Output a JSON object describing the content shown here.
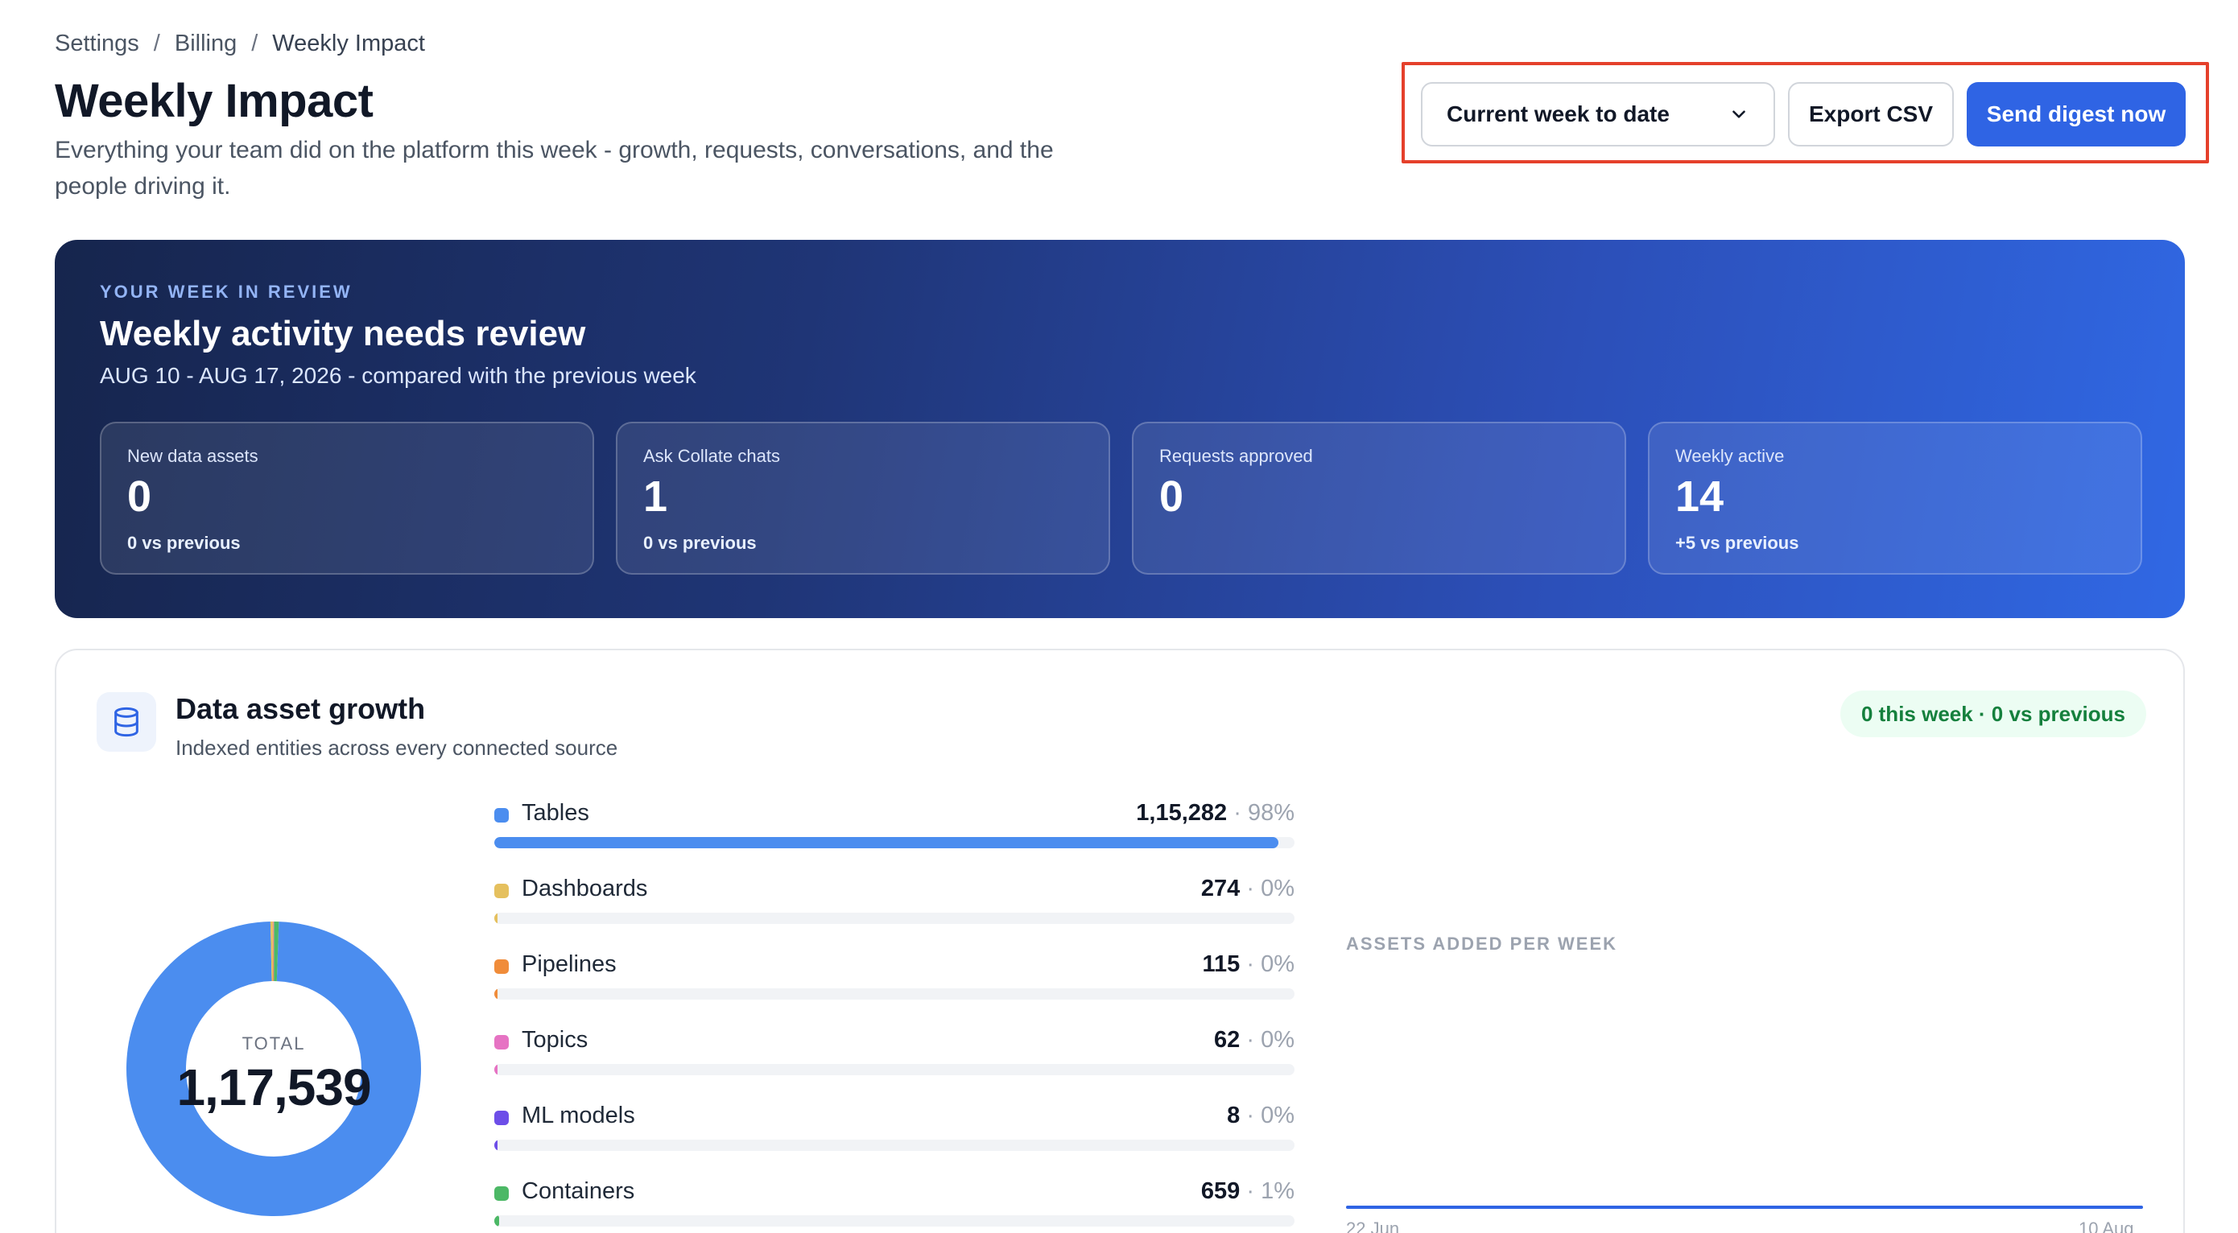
{
  "breadcrumb": [
    "Settings",
    "Billing",
    "Weekly Impact"
  ],
  "breadcrumb_separator": "/",
  "header": {
    "title": "Weekly Impact",
    "subtitle": "Everything your team did on the platform this week - growth, requests, conversations, and the people driving it."
  },
  "toolbar": {
    "period_select": "Current week to date",
    "export_label": "Export CSV",
    "send_label": "Send digest now",
    "select_icon": "chevron-down-icon"
  },
  "hero": {
    "eyebrow": "YOUR WEEK IN REVIEW",
    "title": "Weekly activity needs review",
    "subtitle": "AUG 10 - AUG 17, 2026 - compared with the previous week",
    "stats": [
      {
        "label": "New data assets",
        "value": "0",
        "delta": "0 vs previous"
      },
      {
        "label": "Ask Collate chats",
        "value": "1",
        "delta": "0 vs previous"
      },
      {
        "label": "Requests approved",
        "value": "0",
        "delta": ""
      },
      {
        "label": "Weekly active",
        "value": "14",
        "delta": "+5 vs previous"
      }
    ]
  },
  "growth": {
    "icon": "database-icon",
    "title": "Data asset growth",
    "subtitle": "Indexed entities across every connected source",
    "badge": "0 this week · 0 vs previous",
    "total_label": "TOTAL",
    "total_value": "1,17,539",
    "breakdown": [
      {
        "name": "Tables",
        "value": "1,15,282",
        "pct": "98%",
        "fraction": 0.98,
        "color": "#4b8def"
      },
      {
        "name": "Dashboards",
        "value": "274",
        "pct": "0%",
        "fraction": 0.0023,
        "color": "#e5c05e"
      },
      {
        "name": "Pipelines",
        "value": "115",
        "pct": "0%",
        "fraction": 0.001,
        "color": "#f08c3a"
      },
      {
        "name": "Topics",
        "value": "62",
        "pct": "0%",
        "fraction": 0.0005,
        "color": "#e673c3"
      },
      {
        "name": "ML models",
        "value": "8",
        "pct": "0%",
        "fraction": 0.0001,
        "color": "#6d4ee8"
      },
      {
        "name": "Containers",
        "value": "659",
        "pct": "1%",
        "fraction": 0.0056,
        "color": "#4cb866"
      }
    ],
    "weekly": {
      "label": "ASSETS ADDED PER WEEK",
      "x_start": "22 Jun",
      "x_end": "10 Aug",
      "line_color": "#2f64e4"
    }
  }
}
